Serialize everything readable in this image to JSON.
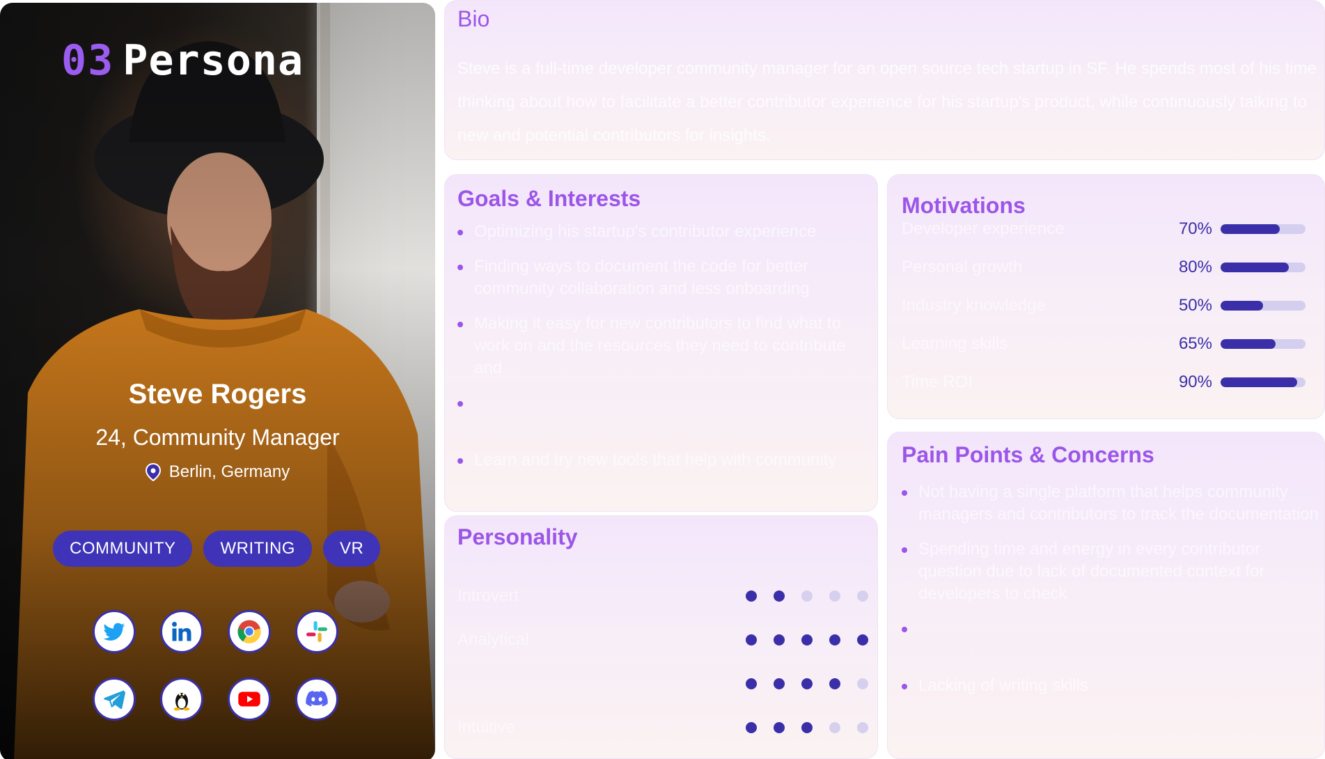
{
  "profile": {
    "logo_number": "03",
    "logo_word": "Persona",
    "name": "Steve Rogers",
    "role": "24, Community Manager",
    "location": "Berlin, Germany",
    "tags": [
      "COMMUNITY",
      "WRITING",
      "VR"
    ],
    "socials": [
      "twitter-icon",
      "linkedin-icon",
      "chrome-icon",
      "slack-icon",
      "telegram-icon",
      "linux-icon",
      "youtube-icon",
      "discord-icon"
    ]
  },
  "bio": {
    "title": "Bio",
    "text": "Steve is a full-time developer community manager for an open source tech startup in SF. He spends most of his time thinking about how to facilitate a better contributor experience for his startup's product, while continuously talking to new and potential contributors for insights."
  },
  "goals": {
    "title": "Goals & Interests",
    "items": [
      "Optimizing his startup's contributor experience",
      "Finding ways to document the code for better community collaboration and less onboarding",
      "Making it easy for new contributors to find what to work on and the resources they need to contribute and",
      "",
      "Learn and try new tools that help with community"
    ]
  },
  "personality": {
    "title": "Personality",
    "traits": [
      {
        "label": "Introvert",
        "level": 2
      },
      {
        "label": "Analytical",
        "level": 5
      },
      {
        "label": "",
        "level": 4
      },
      {
        "label": "Intuitive",
        "level": 3
      }
    ]
  },
  "motivations": {
    "title": "Motivations",
    "items": [
      {
        "label": "Developer experience",
        "percent_text": "70%",
        "value": 70
      },
      {
        "label": "Personal growth",
        "percent_text": "80%",
        "value": 80
      },
      {
        "label": "Industry knowledge",
        "percent_text": "50%",
        "value": 50
      },
      {
        "label": "Learning skills",
        "percent_text": "65%",
        "value": 65
      },
      {
        "label": "Time ROI",
        "percent_text": "90%",
        "value": 90
      }
    ]
  },
  "pains": {
    "title": "Pain Points & Concerns",
    "items": [
      "Not having a single platform that helps community managers and contributors to track the documentation",
      "Spending time and energy in every contributor question due to lack of documented context for developers to check",
      "",
      "Lacking of writing skills"
    ]
  },
  "colors": {
    "accent_purple": "#9b55e8",
    "brand_indigo": "#3a2fa8",
    "tag_bg": "#3f33b8",
    "card_bg_top": "#f3e6fb",
    "card_bg_bottom": "#fbf2f2"
  }
}
